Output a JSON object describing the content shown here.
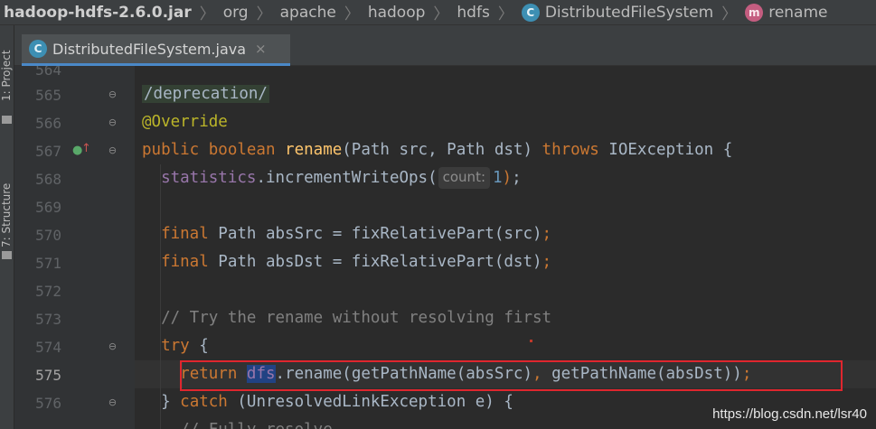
{
  "breadcrumbs": [
    {
      "label": "hadoop-hdfs-2.6.0.jar",
      "kind": "jar"
    },
    {
      "label": "org",
      "kind": "package"
    },
    {
      "label": "apache",
      "kind": "package"
    },
    {
      "label": "hadoop",
      "kind": "package"
    },
    {
      "label": "hdfs",
      "kind": "package"
    },
    {
      "label": "DistributedFileSystem",
      "kind": "class",
      "icon": "C"
    },
    {
      "label": "rename",
      "kind": "method",
      "icon": "m"
    }
  ],
  "tool_strip": {
    "project": "1: Project",
    "structure": "7: Structure"
  },
  "tab": {
    "icon": "C",
    "label": "DistributedFileSystem.java",
    "close": "×"
  },
  "editor": {
    "partial_top_line": "564",
    "lines": [
      {
        "n": "565",
        "code": "/deprecation/"
      },
      {
        "n": "566",
        "code": "@Override"
      },
      {
        "n": "567",
        "code": "public boolean rename(Path src, Path dst) throws IOException {"
      },
      {
        "n": "568",
        "code": "statistics.incrementWriteOps( count: 1);"
      },
      {
        "n": "569",
        "code": ""
      },
      {
        "n": "570",
        "code": "final Path absSrc = fixRelativePart(src);"
      },
      {
        "n": "571",
        "code": "final Path absDst = fixRelativePart(dst);"
      },
      {
        "n": "572",
        "code": ""
      },
      {
        "n": "573",
        "code": "// Try the rename without resolving first"
      },
      {
        "n": "574",
        "code": "try {"
      },
      {
        "n": "575",
        "code": "return dfs.rename(getPathName(absSrc), getPathName(absDst));"
      },
      {
        "n": "576",
        "code": "} catch (UnresolvedLinkException e) {"
      }
    ],
    "current_line": "575",
    "selected_word": "dfs",
    "param_hint": "count:"
  },
  "watermark": "https://blog.csdn.net/lsr40",
  "colors": {
    "keyword": "#cc7832",
    "annotation": "#bbb529",
    "method_decl": "#ffc66d",
    "field": "#9876aa",
    "number": "#6897bb",
    "comment": "#808080",
    "highlight_box": "#e0262e"
  }
}
